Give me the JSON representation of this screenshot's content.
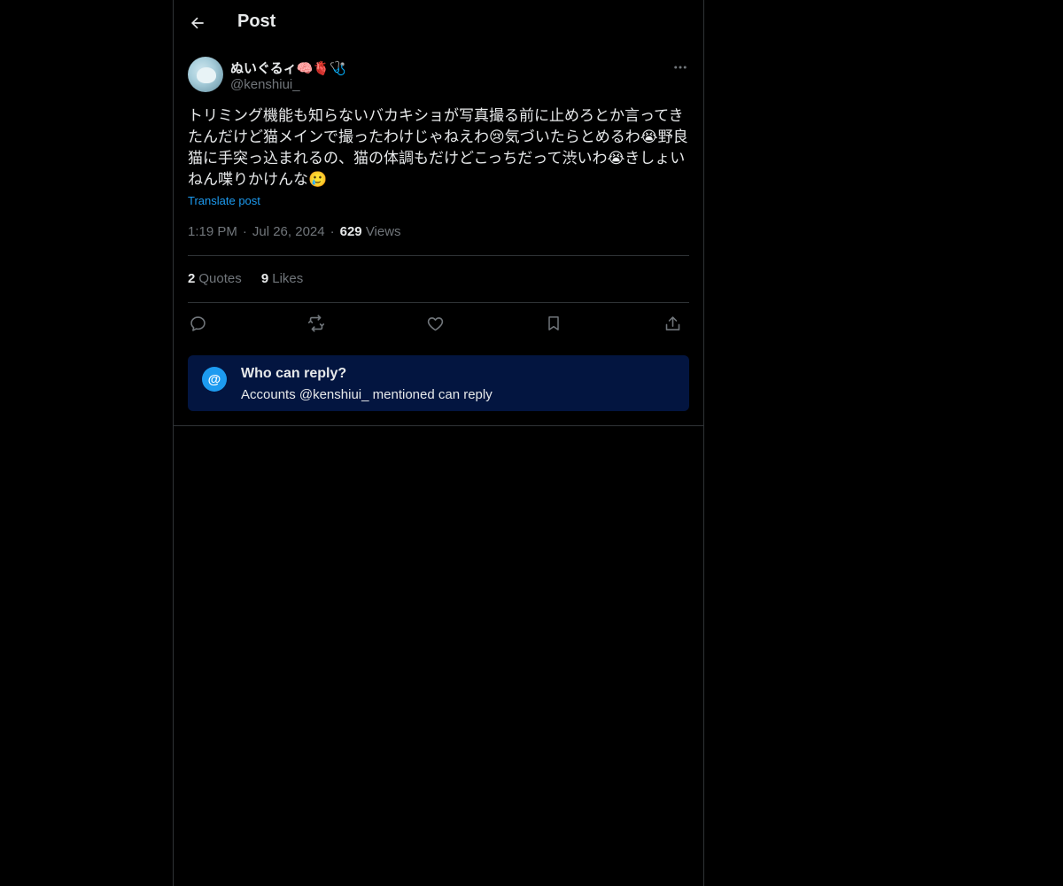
{
  "header": {
    "back_icon": "arrow-left-icon",
    "title": "Post"
  },
  "post": {
    "author": {
      "display_name": "ぬいぐるィ🧠🫀🩺",
      "handle": "@kenshiui_",
      "avatar_icon": "avatar"
    },
    "more_icon": "more-horizontal-icon",
    "text": "トリミング機能も知らないバカキショが写真撮る前に止めろとか言ってきたんだけど猫メインで撮ったわけじゃねえわ😢気づいたらとめるわ😭野良猫に手突っ込まれるの、猫の体調もだけどこっちだって渋いわ😭きしょいねん喋りかけんな🥲",
    "translate_label": "Translate post",
    "time": "1:19 PM",
    "date": "Jul 26, 2024",
    "views_count": "629",
    "views_label": "Views",
    "stats": {
      "quotes_count": "2",
      "quotes_label": "Quotes",
      "likes_count": "9",
      "likes_label": "Likes"
    },
    "actions": [
      {
        "name": "reply",
        "icon": "reply-icon"
      },
      {
        "name": "repost",
        "icon": "repost-icon"
      },
      {
        "name": "like",
        "icon": "heart-icon"
      },
      {
        "name": "bookmark",
        "icon": "bookmark-icon"
      },
      {
        "name": "share",
        "icon": "share-icon"
      }
    ]
  },
  "reply_restriction": {
    "icon": "at-icon",
    "icon_glyph": "@",
    "title": "Who can reply?",
    "description": "Accounts @kenshiui_ mentioned can reply"
  },
  "colors": {
    "background": "#000000",
    "text": "#e7e9ea",
    "muted": "#71767b",
    "accent": "#1d9bf0",
    "border": "#2f3336",
    "reply_box": "#031540"
  }
}
